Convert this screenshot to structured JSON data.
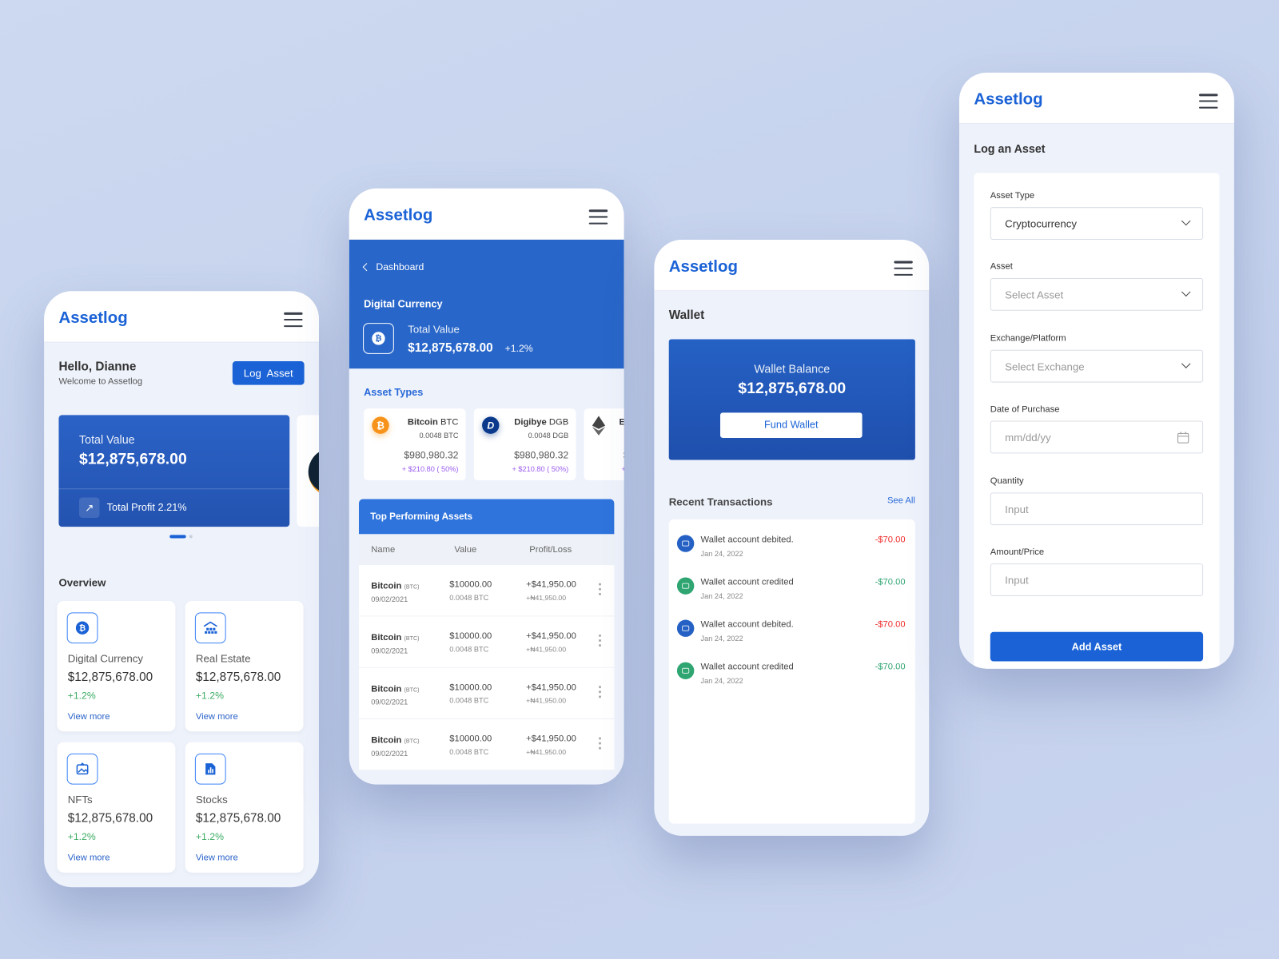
{
  "app_name": "Assetlog",
  "colors": {
    "brand": "#1a62d6",
    "positive": "#3bab62",
    "negative": "#ef2b2b",
    "background": "#c9d5ee"
  },
  "home": {
    "greeting": "Hello, Dianne",
    "welcome": "Welcome to Assetlog",
    "log_asset_label": "Log  Asset",
    "total_value_label": "Total Value",
    "total_value": "$12,875,678.00",
    "total_profit": "Total Profit 2.21%",
    "carousel": {
      "active_index": 0,
      "count": 2
    },
    "overview_title": "Overview",
    "overview": [
      {
        "label": "Digital Currency",
        "value": "$12,875,678.00",
        "change": "+1.2%",
        "link": "View more",
        "icon": "bitcoin-icon"
      },
      {
        "label": "Real Estate",
        "value": "$12,875,678.00",
        "change": "+1.2%",
        "link": "View more",
        "icon": "building-icon"
      },
      {
        "label": "NFTs",
        "value": "$12,875,678.00",
        "change": "+1.2%",
        "link": "View more",
        "icon": "image-icon"
      },
      {
        "label": "Stocks",
        "value": "$12,875,678.00",
        "change": "+1.2%",
        "link": "View more",
        "icon": "chart-file-icon"
      }
    ]
  },
  "digital": {
    "back_label": "Dashboard",
    "title": "Digital Currency",
    "total_value_label": "Total Value",
    "total_value": "$12,875,678.00",
    "change": "+1.2%",
    "asset_types_title": "Asset Types",
    "asset_types": [
      {
        "name": "Bitcoin",
        "symbol": "BTC",
        "qty": "0.0048 BTC",
        "price": "$980,980.32",
        "change": "+ $210.80 ( 50%)"
      },
      {
        "name": "Digibye",
        "symbol": "DGB",
        "qty": "0.0048 DGB",
        "price": "$980,980.32",
        "change": "+ $210.80 ( 50%)"
      },
      {
        "name": "E",
        "symbol": "",
        "qty": "",
        "price": "$",
        "change": "+"
      }
    ],
    "top_title": "Top Performing Assets",
    "columns": [
      "Name",
      "Value",
      "Profit/Loss"
    ],
    "rows": [
      {
        "name": "Bitcoin",
        "sym": "(BTC)",
        "date": "09/02/2021",
        "value": "$10000.00",
        "qty": "0.0048 BTC",
        "pl": "+$41,950.00",
        "pl_ngn": "+₦41,950.00"
      },
      {
        "name": "Bitcoin",
        "sym": "(BTC)",
        "date": "09/02/2021",
        "value": "$10000.00",
        "qty": "0.0048 BTC",
        "pl": "+$41,950.00",
        "pl_ngn": "+₦41,950.00"
      },
      {
        "name": "Bitcoin",
        "sym": "(BTC)",
        "date": "09/02/2021",
        "value": "$10000.00",
        "qty": "0.0048 BTC",
        "pl": "+$41,950.00",
        "pl_ngn": "+₦41,950.00"
      },
      {
        "name": "Bitcoin",
        "sym": "(BTC)",
        "date": "09/02/2021",
        "value": "$10000.00",
        "qty": "0.0048 BTC",
        "pl": "+$41,950.00",
        "pl_ngn": "+₦41,950.00"
      }
    ]
  },
  "wallet": {
    "title": "Wallet",
    "balance_label": "Wallet Balance",
    "balance": "$12,875,678.00",
    "fund_label": "Fund Wallet",
    "recent_title": "Recent Transactions",
    "see_all": "See All",
    "transactions": [
      {
        "text": "Wallet account debited.",
        "date": "Jan 24, 2022",
        "amount": "-$70.00",
        "type": "debit"
      },
      {
        "text": "Wallet account credited",
        "date": "Jan 24, 2022",
        "amount": "-$70.00",
        "type": "credit"
      },
      {
        "text": "Wallet account debited.",
        "date": "Jan 24, 2022",
        "amount": "-$70.00",
        "type": "debit"
      },
      {
        "text": "Wallet account credited",
        "date": "Jan 24, 2022",
        "amount": "-$70.00",
        "type": "credit"
      }
    ]
  },
  "log": {
    "title": "Log an Asset",
    "fields": [
      {
        "label": "Asset Type",
        "value": "Cryptocurrency",
        "placeholder": "",
        "kind": "select"
      },
      {
        "label": "Asset",
        "value": "",
        "placeholder": "Select Asset",
        "kind": "select"
      },
      {
        "label": "Exchange/Platform",
        "value": "",
        "placeholder": "Select Exchange",
        "kind": "select"
      },
      {
        "label": "Date of Purchase",
        "value": "",
        "placeholder": "mm/dd/yy",
        "kind": "date"
      },
      {
        "label": "Quantity",
        "value": "",
        "placeholder": "Input",
        "kind": "text"
      },
      {
        "label": "Amount/Price",
        "value": "",
        "placeholder": "Input",
        "kind": "text"
      }
    ],
    "submit_label": "Add Asset"
  }
}
